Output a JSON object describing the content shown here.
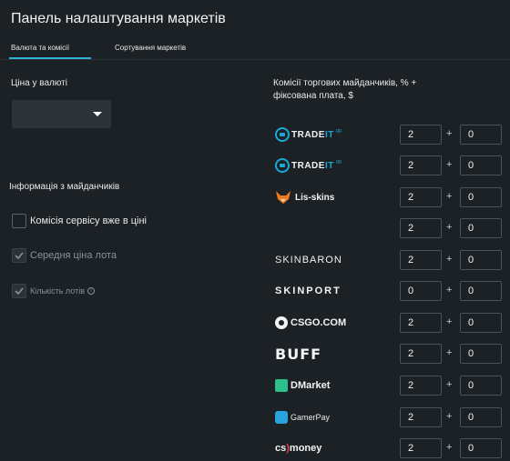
{
  "page": {
    "title": "Панель налаштування маркетів"
  },
  "tabs": [
    {
      "label": "Валюта та комісії",
      "active": true
    },
    {
      "label": "Сортування маркетів",
      "active": false
    }
  ],
  "left": {
    "currency_label": "Ціна у валюті",
    "currency_value": "",
    "info_title": "Інформація з майданчиків",
    "checkboxes": [
      {
        "label": "Комісія сервісу вже в ціні",
        "checked": false,
        "enabled": true
      },
      {
        "label": "Середня ціна лота",
        "checked": true,
        "enabled": false
      },
      {
        "label": "Кількість лотів",
        "checked": true,
        "enabled": false,
        "info_icon": "info-icon"
      }
    ]
  },
  "right": {
    "header": "Комісії торгових майданчиків, % + фіксована плата, $",
    "plus": "+",
    "markets": [
      {
        "logo_icon": "tradeit-logo-icon",
        "logo_text": "TRADE",
        "logo_accent": "IT",
        "logo_suffix": ".gg",
        "percent": "2",
        "fixed": "0"
      },
      {
        "logo_icon": "tradeit-logo-icon",
        "logo_text": "TRADE",
        "logo_accent": "IT",
        "logo_suffix": ".gg",
        "percent": "2",
        "fixed": "0"
      },
      {
        "logo_icon": "lis-skins-logo-icon",
        "logo_text": "Lis-skins",
        "percent": "2",
        "fixed": "0"
      },
      {
        "logo_icon": "",
        "logo_text": "",
        "percent": "2",
        "fixed": "0"
      },
      {
        "logo_icon": "skinbaron-logo-icon",
        "logo_text_bold": "SKIN",
        "logo_text": "BARON",
        "percent": "2",
        "fixed": "0"
      },
      {
        "logo_icon": "skinport-logo-icon",
        "logo_text": "SKINPORT",
        "percent": "0",
        "fixed": "0"
      },
      {
        "logo_icon": "csgo-com-logo-icon",
        "logo_text": "CSGO.COM",
        "percent": "2",
        "fixed": "0"
      },
      {
        "logo_icon": "buff-logo-icon",
        "logo_text": "BUFF",
        "percent": "2",
        "fixed": "0"
      },
      {
        "logo_icon": "dmarket-logo-icon",
        "logo_text": "DMarket",
        "percent": "2",
        "fixed": "0"
      },
      {
        "logo_icon": "gamerpay-logo-icon",
        "logo_text": "GamerPay",
        "percent": "2",
        "fixed": "0"
      },
      {
        "logo_icon": "csmoney-logo-icon",
        "logo_text_a": "cs",
        "logo_text_b": ")",
        "logo_text_c": "money",
        "percent": "2",
        "fixed": "0"
      }
    ]
  },
  "colors": {
    "background": "#1c2126",
    "accent": "#2fb3d1",
    "input_border": "#4a535a"
  }
}
